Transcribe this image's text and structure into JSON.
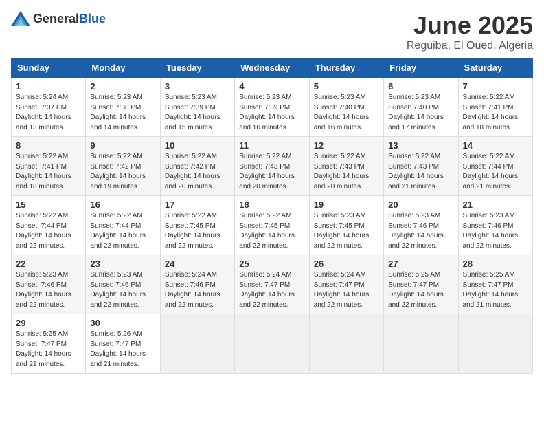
{
  "header": {
    "logo_general": "General",
    "logo_blue": "Blue",
    "month_title": "June 2025",
    "location": "Reguiba, El Oued, Algeria"
  },
  "calendar": {
    "days_of_week": [
      "Sunday",
      "Monday",
      "Tuesday",
      "Wednesday",
      "Thursday",
      "Friday",
      "Saturday"
    ],
    "weeks": [
      [
        {
          "day": "",
          "info": ""
        },
        {
          "day": "2",
          "info": "Sunrise: 5:23 AM\nSunset: 7:38 PM\nDaylight: 14 hours and 14 minutes."
        },
        {
          "day": "3",
          "info": "Sunrise: 5:23 AM\nSunset: 7:39 PM\nDaylight: 14 hours and 15 minutes."
        },
        {
          "day": "4",
          "info": "Sunrise: 5:23 AM\nSunset: 7:39 PM\nDaylight: 14 hours and 16 minutes."
        },
        {
          "day": "5",
          "info": "Sunrise: 5:23 AM\nSunset: 7:40 PM\nDaylight: 14 hours and 16 minutes."
        },
        {
          "day": "6",
          "info": "Sunrise: 5:23 AM\nSunset: 7:40 PM\nDaylight: 14 hours and 17 minutes."
        },
        {
          "day": "7",
          "info": "Sunrise: 5:22 AM\nSunset: 7:41 PM\nDaylight: 14 hours and 18 minutes."
        }
      ],
      [
        {
          "day": "1",
          "info": "Sunrise: 5:24 AM\nSunset: 7:37 PM\nDaylight: 14 hours and 13 minutes."
        },
        {
          "day": "8",
          "info": "Sunrise: 5:22 AM\nSunset: 7:41 PM\nDaylight: 14 hours and 18 minutes."
        },
        {
          "day": "9",
          "info": "Sunrise: 5:22 AM\nSunset: 7:42 PM\nDaylight: 14 hours and 19 minutes."
        },
        {
          "day": "10",
          "info": "Sunrise: 5:22 AM\nSunset: 7:42 PM\nDaylight: 14 hours and 20 minutes."
        },
        {
          "day": "11",
          "info": "Sunrise: 5:22 AM\nSunset: 7:43 PM\nDaylight: 14 hours and 20 minutes."
        },
        {
          "day": "12",
          "info": "Sunrise: 5:22 AM\nSunset: 7:43 PM\nDaylight: 14 hours and 20 minutes."
        },
        {
          "day": "13",
          "info": "Sunrise: 5:22 AM\nSunset: 7:43 PM\nDaylight: 14 hours and 21 minutes."
        },
        {
          "day": "14",
          "info": "Sunrise: 5:22 AM\nSunset: 7:44 PM\nDaylight: 14 hours and 21 minutes."
        }
      ],
      [
        {
          "day": "15",
          "info": "Sunrise: 5:22 AM\nSunset: 7:44 PM\nDaylight: 14 hours and 22 minutes."
        },
        {
          "day": "16",
          "info": "Sunrise: 5:22 AM\nSunset: 7:44 PM\nDaylight: 14 hours and 22 minutes."
        },
        {
          "day": "17",
          "info": "Sunrise: 5:22 AM\nSunset: 7:45 PM\nDaylight: 14 hours and 22 minutes."
        },
        {
          "day": "18",
          "info": "Sunrise: 5:22 AM\nSunset: 7:45 PM\nDaylight: 14 hours and 22 minutes."
        },
        {
          "day": "19",
          "info": "Sunrise: 5:23 AM\nSunset: 7:45 PM\nDaylight: 14 hours and 22 minutes."
        },
        {
          "day": "20",
          "info": "Sunrise: 5:23 AM\nSunset: 7:46 PM\nDaylight: 14 hours and 22 minutes."
        },
        {
          "day": "21",
          "info": "Sunrise: 5:23 AM\nSunset: 7:46 PM\nDaylight: 14 hours and 22 minutes."
        }
      ],
      [
        {
          "day": "22",
          "info": "Sunrise: 5:23 AM\nSunset: 7:46 PM\nDaylight: 14 hours and 22 minutes."
        },
        {
          "day": "23",
          "info": "Sunrise: 5:23 AM\nSunset: 7:46 PM\nDaylight: 14 hours and 22 minutes."
        },
        {
          "day": "24",
          "info": "Sunrise: 5:24 AM\nSunset: 7:46 PM\nDaylight: 14 hours and 22 minutes."
        },
        {
          "day": "25",
          "info": "Sunrise: 5:24 AM\nSunset: 7:47 PM\nDaylight: 14 hours and 22 minutes."
        },
        {
          "day": "26",
          "info": "Sunrise: 5:24 AM\nSunset: 7:47 PM\nDaylight: 14 hours and 22 minutes."
        },
        {
          "day": "27",
          "info": "Sunrise: 5:25 AM\nSunset: 7:47 PM\nDaylight: 14 hours and 22 minutes."
        },
        {
          "day": "28",
          "info": "Sunrise: 5:25 AM\nSunset: 7:47 PM\nDaylight: 14 hours and 21 minutes."
        }
      ],
      [
        {
          "day": "29",
          "info": "Sunrise: 5:25 AM\nSunset: 7:47 PM\nDaylight: 14 hours and 21 minutes."
        },
        {
          "day": "30",
          "info": "Sunrise: 5:26 AM\nSunset: 7:47 PM\nDaylight: 14 hours and 21 minutes."
        },
        {
          "day": "",
          "info": ""
        },
        {
          "day": "",
          "info": ""
        },
        {
          "day": "",
          "info": ""
        },
        {
          "day": "",
          "info": ""
        },
        {
          "day": "",
          "info": ""
        }
      ]
    ]
  }
}
